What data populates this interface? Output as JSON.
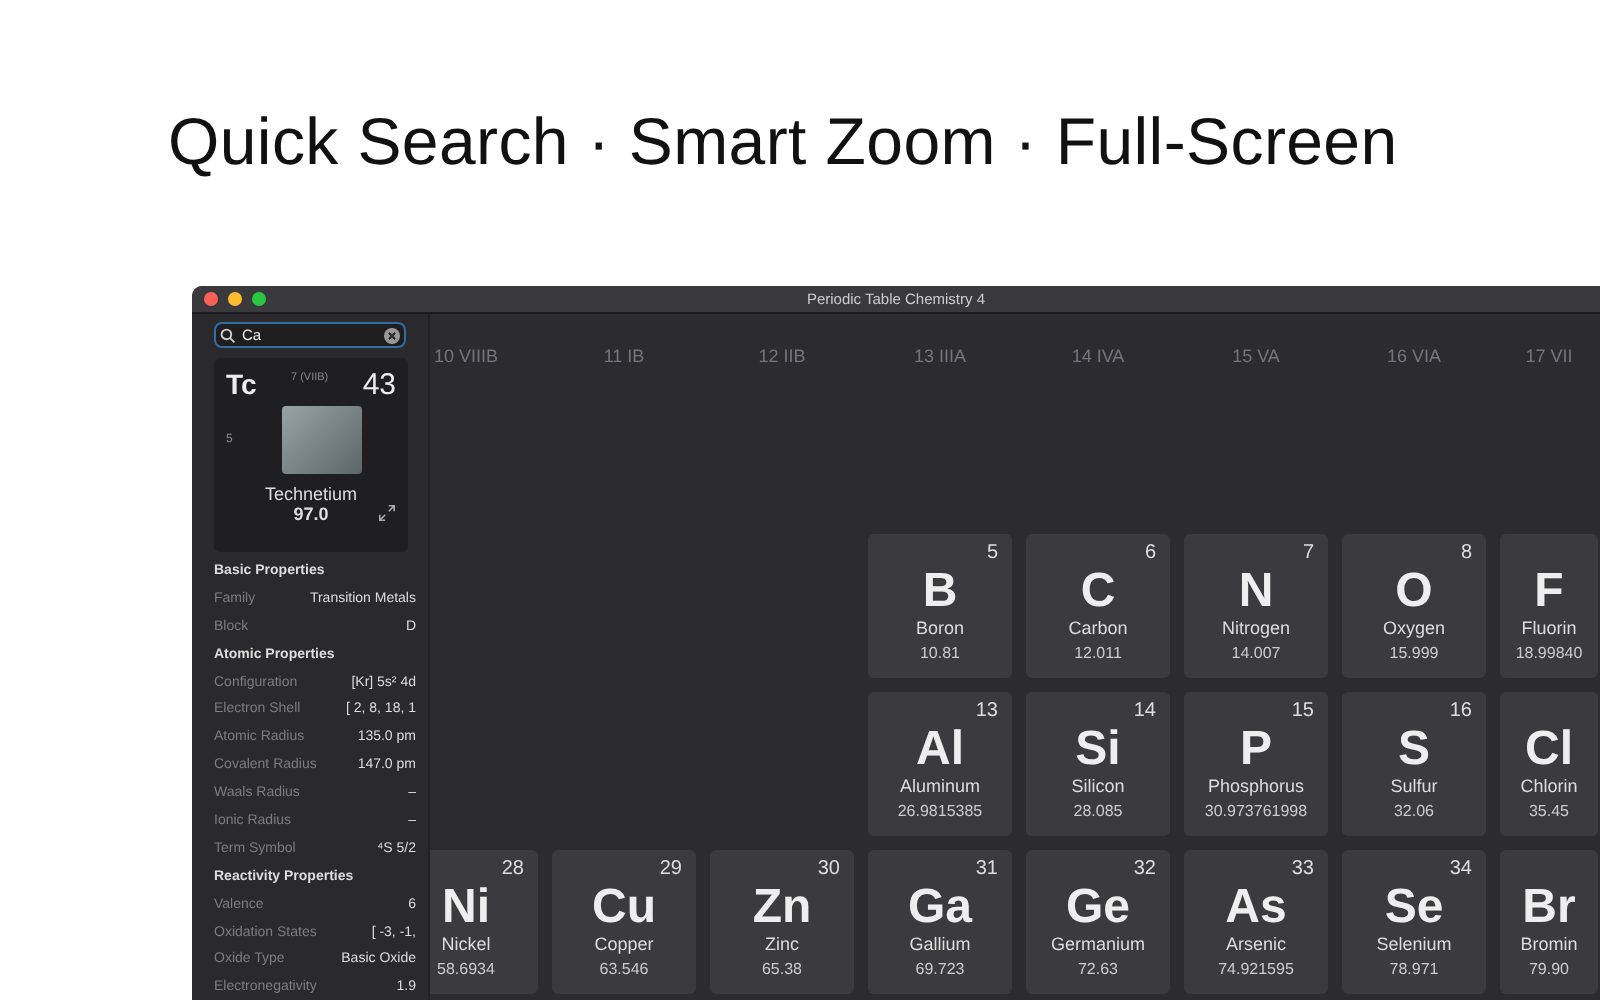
{
  "headline": "Quick Search · Smart Zoom · Full-Screen",
  "window": {
    "title": "Periodic Table Chemistry 4"
  },
  "search": {
    "value": "Ca"
  },
  "card": {
    "symbol": "Tc",
    "group": "7 (VIIB)",
    "number": "43",
    "period": "5",
    "name": "Technetium",
    "mass": "97.0"
  },
  "sections": [
    {
      "title": "Basic Properties",
      "rows": [
        {
          "label": "Family",
          "value": "Transition Metals"
        },
        {
          "label": "Block",
          "value": "D"
        }
      ]
    },
    {
      "title": "Atomic Properties",
      "rows": [
        {
          "label": "Configuration",
          "value": "[Kr] 5s² 4d"
        },
        {
          "label": "Electron Shell",
          "value": "[ 2, 8, 18, 1"
        },
        {
          "label": "Atomic Radius",
          "value": "135.0 pm"
        },
        {
          "label": "Covalent Radius",
          "value": "147.0 pm"
        },
        {
          "label": "Waals Radius",
          "value": "–"
        },
        {
          "label": "Ionic Radius",
          "value": "–"
        },
        {
          "label": "Term Symbol",
          "value": "⁴S 5/2"
        }
      ]
    },
    {
      "title": "Reactivity Properties",
      "rows": [
        {
          "label": "Valence",
          "value": "6"
        },
        {
          "label": "Oxidation States",
          "value": "[ -3, -1,"
        },
        {
          "label": "Oxide Type",
          "value": "Basic Oxide"
        },
        {
          "label": "Electronegativity",
          "value": "1.9"
        }
      ]
    }
  ],
  "groups": [
    "10 VIIIB",
    "11 IB",
    "12 IIB",
    "13 IIIA",
    "14 IVA",
    "15 VA",
    "16 VIA",
    "17 VII"
  ],
  "periods": [
    {
      "tiles": [
        {
          "number": "5",
          "symbol": "B",
          "name": "Boron",
          "mass": "10.81"
        },
        {
          "number": "6",
          "symbol": "C",
          "name": "Carbon",
          "mass": "12.011"
        },
        {
          "number": "7",
          "symbol": "N",
          "name": "Nitrogen",
          "mass": "14.007"
        },
        {
          "number": "8",
          "symbol": "O",
          "name": "Oxygen",
          "mass": "15.999"
        },
        {
          "symbol": "F",
          "name": "Fluorin",
          "mass": "18.99840"
        }
      ]
    },
    {
      "tiles": [
        {
          "number": "13",
          "symbol": "Al",
          "name": "Aluminum",
          "mass": "26.9815385"
        },
        {
          "number": "14",
          "symbol": "Si",
          "name": "Silicon",
          "mass": "28.085"
        },
        {
          "number": "15",
          "symbol": "P",
          "name": "Phosphorus",
          "mass": "30.973761998"
        },
        {
          "number": "16",
          "symbol": "S",
          "name": "Sulfur",
          "mass": "32.06"
        },
        {
          "symbol": "Cl",
          "name": "Chlorin",
          "mass": "35.45"
        }
      ]
    },
    {
      "tiles": [
        {
          "number": "28",
          "symbol": "Ni",
          "name": "Nickel",
          "mass": "58.6934"
        },
        {
          "number": "29",
          "symbol": "Cu",
          "name": "Copper",
          "mass": "63.546"
        },
        {
          "number": "30",
          "symbol": "Zn",
          "name": "Zinc",
          "mass": "65.38"
        },
        {
          "number": "31",
          "symbol": "Ga",
          "name": "Gallium",
          "mass": "69.723"
        },
        {
          "number": "32",
          "symbol": "Ge",
          "name": "Germanium",
          "mass": "72.63"
        },
        {
          "number": "33",
          "symbol": "As",
          "name": "Arsenic",
          "mass": "74.921595"
        },
        {
          "number": "34",
          "symbol": "Se",
          "name": "Selenium",
          "mass": "78.971"
        },
        {
          "symbol": "Br",
          "name": "Bromin",
          "mass": "79.90"
        }
      ]
    }
  ]
}
